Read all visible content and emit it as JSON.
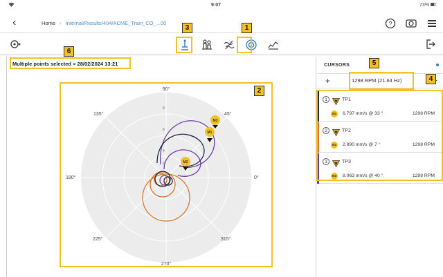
{
  "status_bar": {
    "time": "9:07",
    "battery": "73%"
  },
  "nav": {
    "home": "Home",
    "separator": "›",
    "path": "Internal/Results/404/ACME_Train_CO_...00"
  },
  "callouts": [
    "1",
    "2",
    "3",
    "4",
    "5",
    "6"
  ],
  "plot": {
    "selection_text": "Multiple points selected > 28/02/2024 13:21",
    "angle_labels": {
      "a90": "90°",
      "a45": "45°",
      "a0": "0°",
      "a315": "315°",
      "a270": "270°",
      "a225": "225°",
      "a180": "180°",
      "a135": "135°"
    },
    "radial_labels": [
      "8",
      "6",
      "4",
      "2"
    ],
    "markers": [
      "M1",
      "M2",
      "M3"
    ],
    "colors": {
      "tp1": "#1f2a44",
      "tp2": "#d9762c",
      "tp3": "#6b3fa0",
      "grid": "#ffffff",
      "disk": "#ececec",
      "highlight": "#f4c022"
    }
  },
  "cursors": {
    "title": "CURSORS",
    "plus": "+",
    "minus": "−",
    "rpm": "1298 RPM (21.64 Hz)",
    "items": [
      {
        "index": "1",
        "name": "TP1",
        "marker": "M1",
        "value": "6.797 mm/s @ 33 °",
        "rpm": "1298 RPM",
        "color": "#1f2a44"
      },
      {
        "index": "2",
        "name": "TP2",
        "marker": "M2",
        "value": "2.890 mm/s @ 7 °",
        "rpm": "1298 RPM",
        "color": "#d9762c"
      },
      {
        "index": "3",
        "name": "TP3",
        "marker": "M3",
        "value": "8.063 mm/s @ 40 °",
        "rpm": "1298 RPM",
        "color": "#6b3fa0"
      }
    ]
  }
}
